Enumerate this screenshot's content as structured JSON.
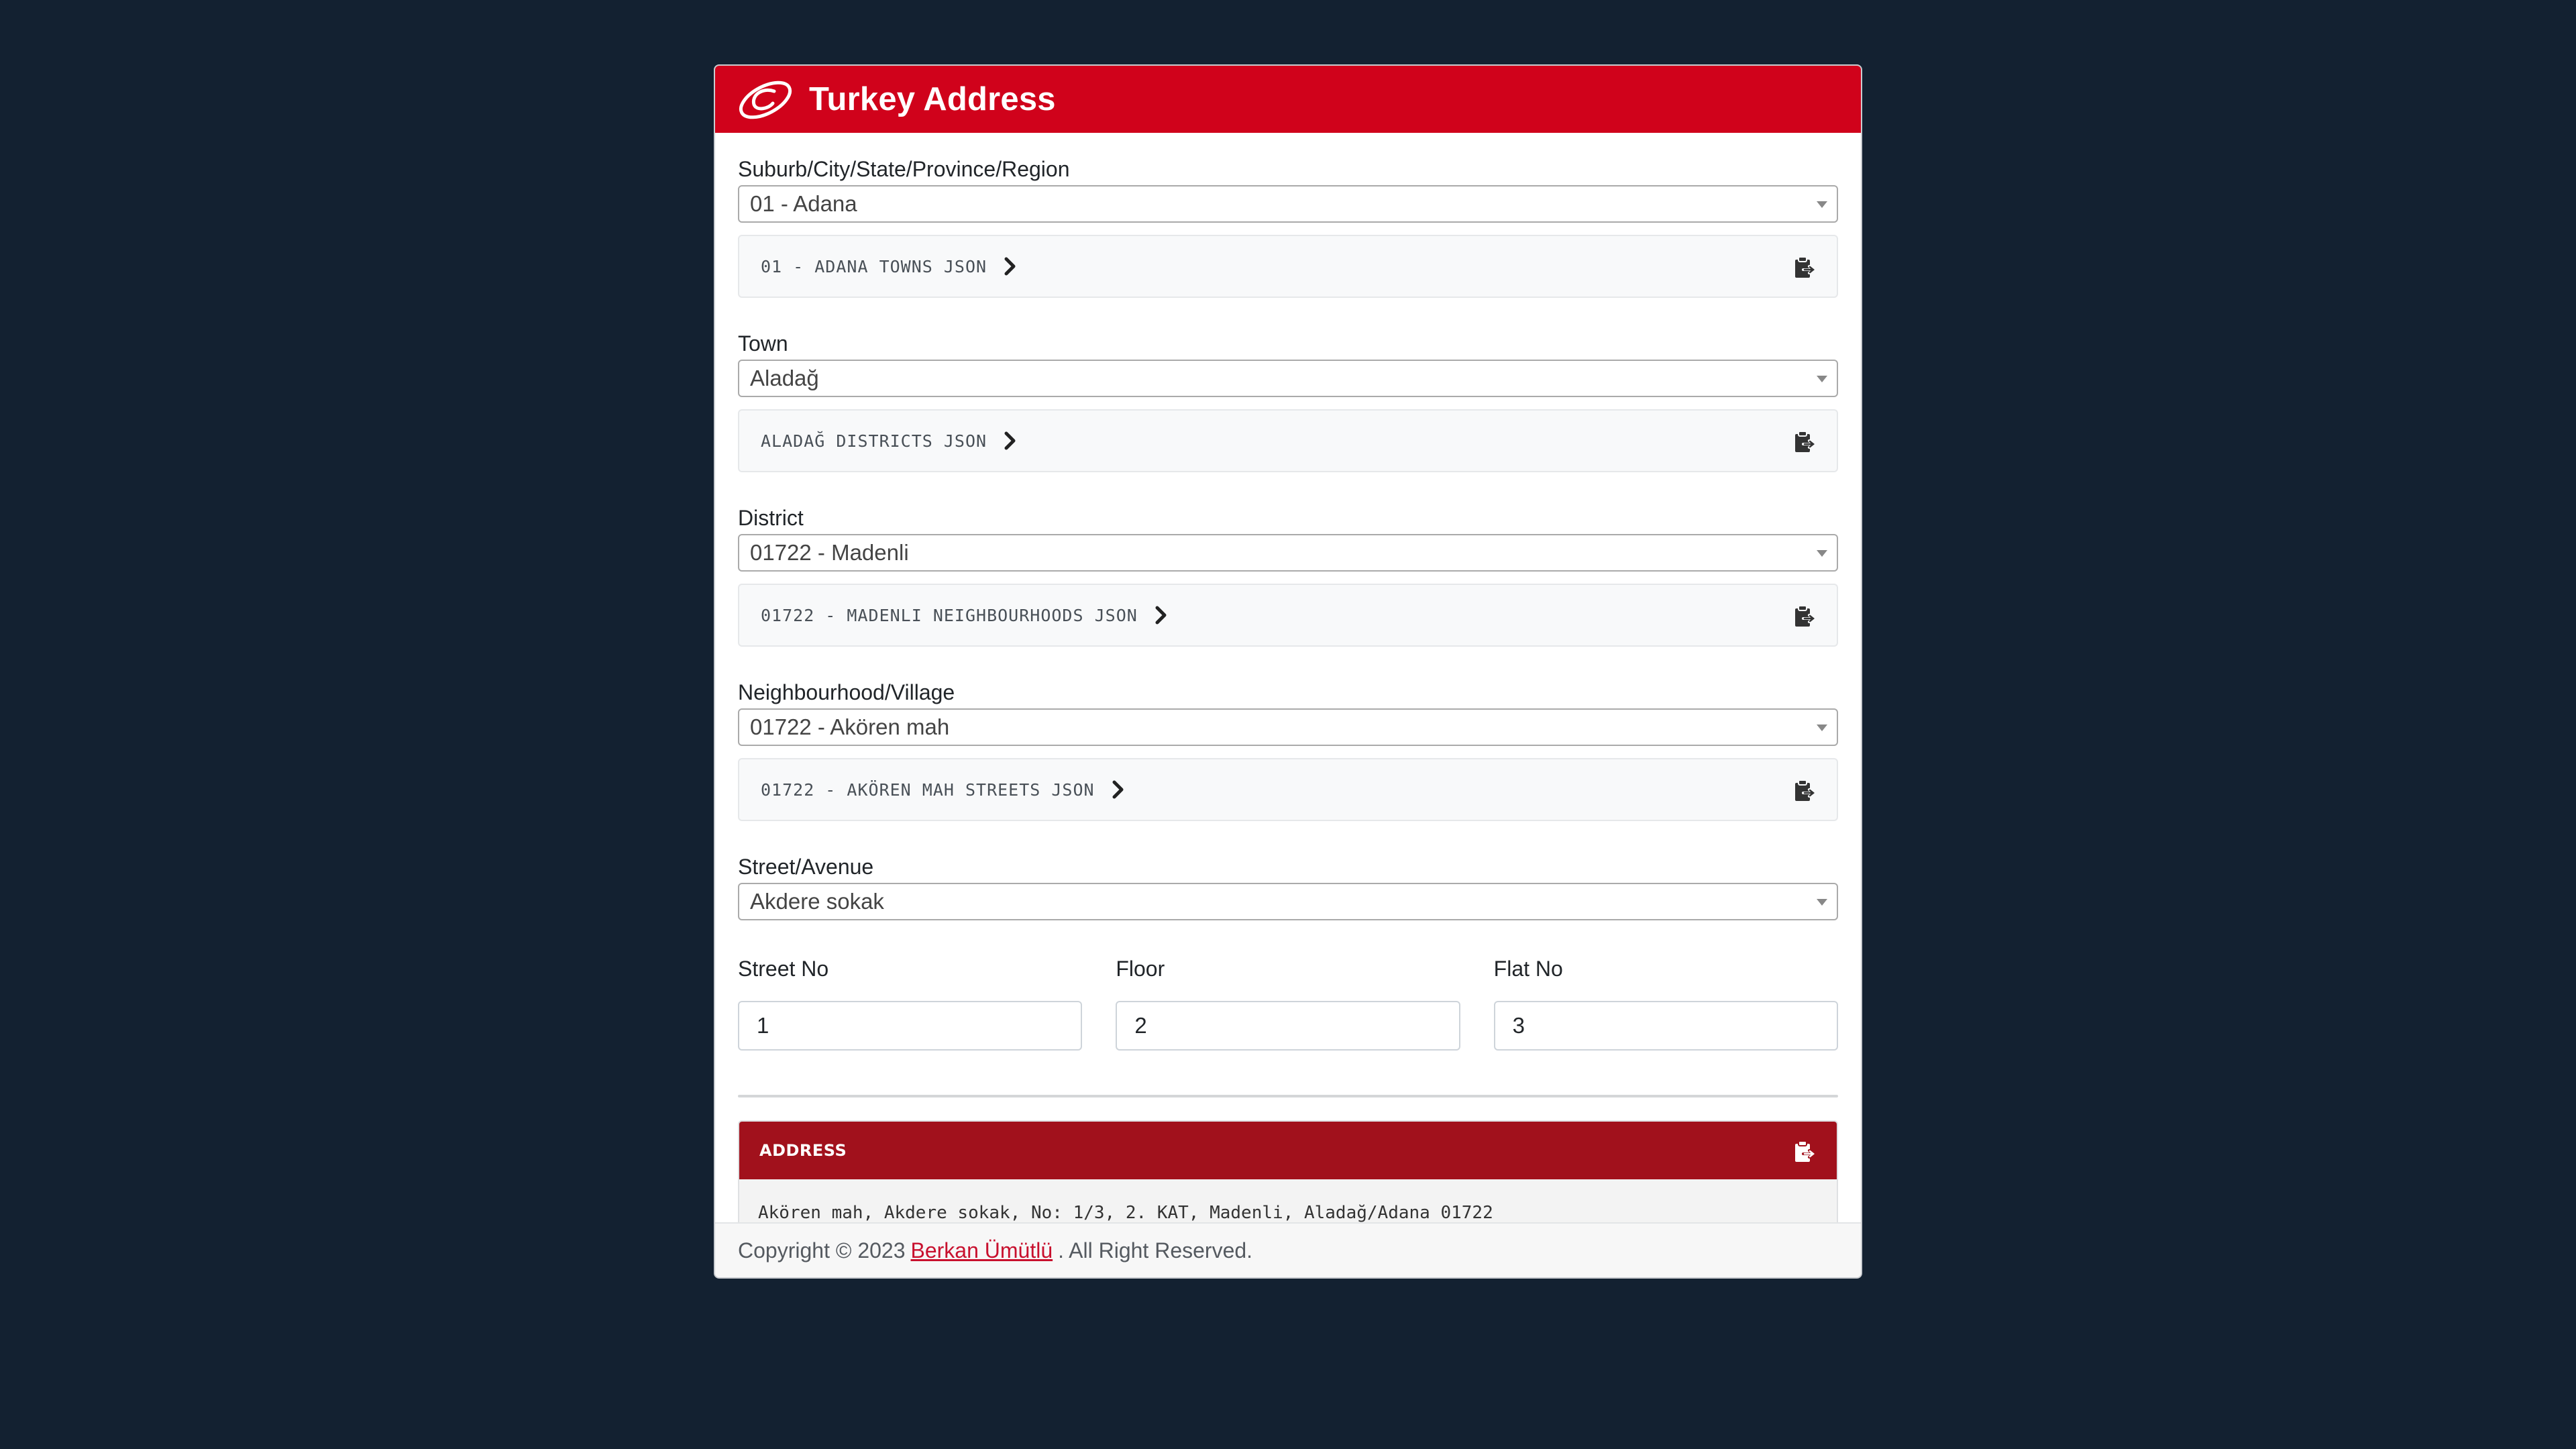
{
  "header": {
    "title": "Turkey Address"
  },
  "province": {
    "label": "Suburb/City/State/Province/Region",
    "selected": "01 - Adana",
    "json_link": "01 - ADANA TOWNS JSON"
  },
  "town": {
    "label": "Town",
    "selected": "Aladağ",
    "json_link": "ALADAĞ DISTRICTS JSON"
  },
  "district": {
    "label": "District",
    "selected": "01722 - Madenli",
    "json_link": "01722 - MADENLI NEIGHBOURHOODS JSON"
  },
  "neighbourhood": {
    "label": "Neighbourhood/Village",
    "selected": "01722 - Akören mah",
    "json_link": "01722 - AKÖREN MAH STREETS JSON"
  },
  "street": {
    "label": "Street/Avenue",
    "selected": "Akdere sokak"
  },
  "street_no": {
    "label": "Street No",
    "value": "1"
  },
  "floor": {
    "label": "Floor",
    "value": "2"
  },
  "flat_no": {
    "label": "Flat No",
    "value": "3"
  },
  "address": {
    "title": "ADDRESS",
    "text": "Akören mah, Akdere sokak, No: 1/3, 2. KAT, Madenli, Aladağ/Adana 01722"
  },
  "footer": {
    "prefix": "Copyright © 2023",
    "author": "Berkan Ümütlü",
    "suffix": ". All Right Reserved."
  },
  "colors": {
    "background": "#132131",
    "header_red": "#d0021b",
    "address_red": "#a1111c"
  },
  "icons": {
    "logo": "ptt-logo",
    "link": "chevron-right-icon",
    "copy": "clipboard-copy-icon"
  }
}
